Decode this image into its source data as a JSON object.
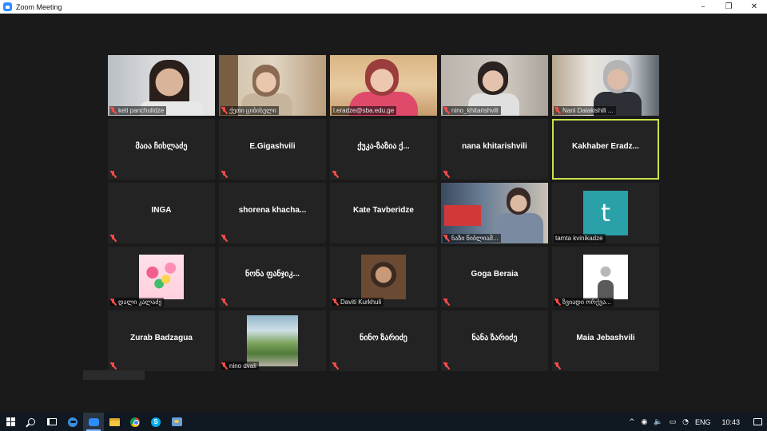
{
  "window": {
    "title": "Zoom Meeting",
    "controls": {
      "minimize": "–",
      "maximize": "❐",
      "close": "✕"
    }
  },
  "meeting": {
    "active_speaker": "Kakhaber  Eradz...",
    "participants": [
      {
        "display_name": "keti  panchulidze",
        "video": true,
        "muted": true,
        "bg": "keti"
      },
      {
        "display_name": "ქეთი ციბისელი",
        "video": true,
        "muted": true,
        "bg": "qeti"
      },
      {
        "display_name": "l.eradze@sba.edu.ge",
        "video": true,
        "muted": false,
        "bg": "leradze"
      },
      {
        "display_name": "nino_khitarishvili",
        "video": true,
        "muted": true,
        "bg": "nino"
      },
      {
        "display_name": "Nani Dalakishili ...",
        "video": true,
        "muted": true,
        "bg": "nani"
      },
      {
        "display_name": "მაია ჩიხლაძე",
        "video": false,
        "muted": true
      },
      {
        "display_name": "E.Gigashvili",
        "video": false,
        "muted": true
      },
      {
        "display_name": "ქუკა-ზაზია  ქ...",
        "video": false,
        "muted": true
      },
      {
        "display_name": "nana khitarishvili",
        "video": false,
        "muted": true
      },
      {
        "display_name": "Kakhaber  Eradz...",
        "video": false,
        "muted": false,
        "active": true
      },
      {
        "display_name": "INGA",
        "video": false,
        "muted": true
      },
      {
        "display_name": "shorena  khacha...",
        "video": false,
        "muted": true
      },
      {
        "display_name": "Kate Tavberidze",
        "video": false,
        "muted": false
      },
      {
        "display_name": "ნაზი წიბლიაშ...",
        "video": true,
        "muted": true,
        "bg": "nazi"
      },
      {
        "display_name": "tamta kvinikadze",
        "video": false,
        "muted": false,
        "avatar": "t",
        "avatar_letter": "t"
      },
      {
        "display_name": "დალი  კალაძე",
        "video": false,
        "muted": true,
        "avatar": "flowers"
      },
      {
        "display_name": "ნონა  ფანჯიკ...",
        "video": false,
        "muted": true
      },
      {
        "display_name": "Daviti Kurkhuli",
        "video": false,
        "muted": true,
        "avatar": "daviti"
      },
      {
        "display_name": "Goga Beraia",
        "video": false,
        "muted": true
      },
      {
        "display_name": "ზვიადი ორქვა...",
        "video": false,
        "muted": true,
        "avatar": "zviadi"
      },
      {
        "display_name": "Zurab Badzagua",
        "video": false,
        "muted": true
      },
      {
        "display_name": "nino dvali",
        "video": false,
        "muted": true,
        "avatar": "dvali"
      },
      {
        "display_name": "ნინო ზარიძე",
        "video": false,
        "muted": true
      },
      {
        "display_name": "ნანა ზარიძე",
        "video": false,
        "muted": true
      },
      {
        "display_name": "Maia  Jebashvili",
        "video": false,
        "muted": true
      }
    ]
  },
  "taskbar": {
    "apps": [
      "start",
      "search",
      "task-view",
      "edge",
      "zoom",
      "file-explorer",
      "chrome",
      "skype",
      "paint"
    ],
    "active_app": "zoom",
    "tray": {
      "chevron": "^",
      "language": "ENG",
      "time": "10:43"
    }
  }
}
